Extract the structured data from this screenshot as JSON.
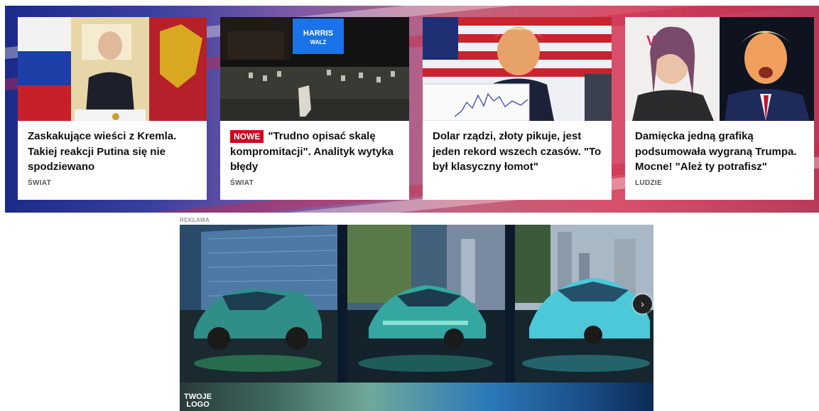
{
  "articles": [
    {
      "title": "Zaskakujące wieści z Kremla. Takiej reakcji Putina się nie spodziewano",
      "badge": "",
      "category": "ŚWIAT",
      "image": "putin-at-podium"
    },
    {
      "title": "\"Trudno opisać skalę kompromitacji\". Analityk wytyka błędy",
      "badge": "NOWE",
      "category": "ŚWIAT",
      "image": "empty-rally-venue"
    },
    {
      "title": "Dolar rządzi, złoty pikuje, jest jeden rekord wszech czasów. \"To był klasyczny łomot\"",
      "badge": "",
      "category": "",
      "image": "trump-with-chart"
    },
    {
      "title": "Damięcka jedną grafiką podsumowała wygraną Trumpa. Mocne! \"Ależ ty potrafisz\"",
      "badge": "",
      "category": "LUDZIE",
      "image": "damiecka-and-trump"
    }
  ],
  "thumbs": {
    "screen_text_1": "HARRIS",
    "screen_text_2": "WALZ"
  },
  "ad": {
    "label": "REKLAMA",
    "logo_line1": "TWOJE",
    "logo_line2": "LOGO",
    "next_icon": "chevron-right-icon"
  }
}
